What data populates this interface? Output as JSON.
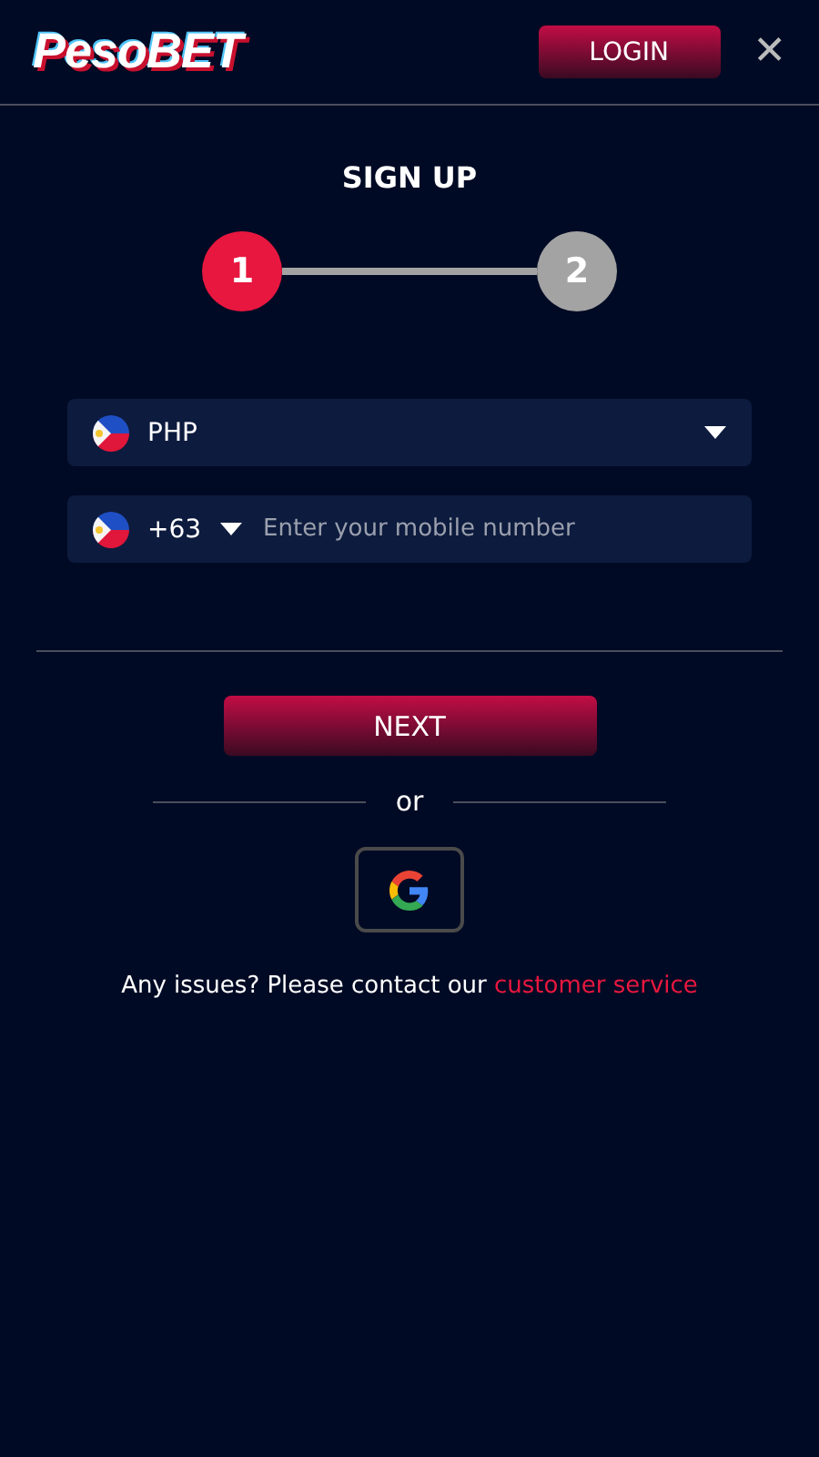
{
  "header": {
    "logo": "PesoBET",
    "login_button": "LOGIN",
    "close": "✕"
  },
  "title": "SIGN UP",
  "steps": [
    {
      "label": "1",
      "selected": true
    },
    {
      "label": "2",
      "selected": false
    }
  ],
  "currency_select": {
    "value": "PHP"
  },
  "phone_field": {
    "country_code": "+63",
    "placeholder": "Enter your mobile number"
  },
  "next_button": "NEXT",
  "separator": "or",
  "footer_text": "Any issues? Please contact our ",
  "footer_link": "customer service"
}
